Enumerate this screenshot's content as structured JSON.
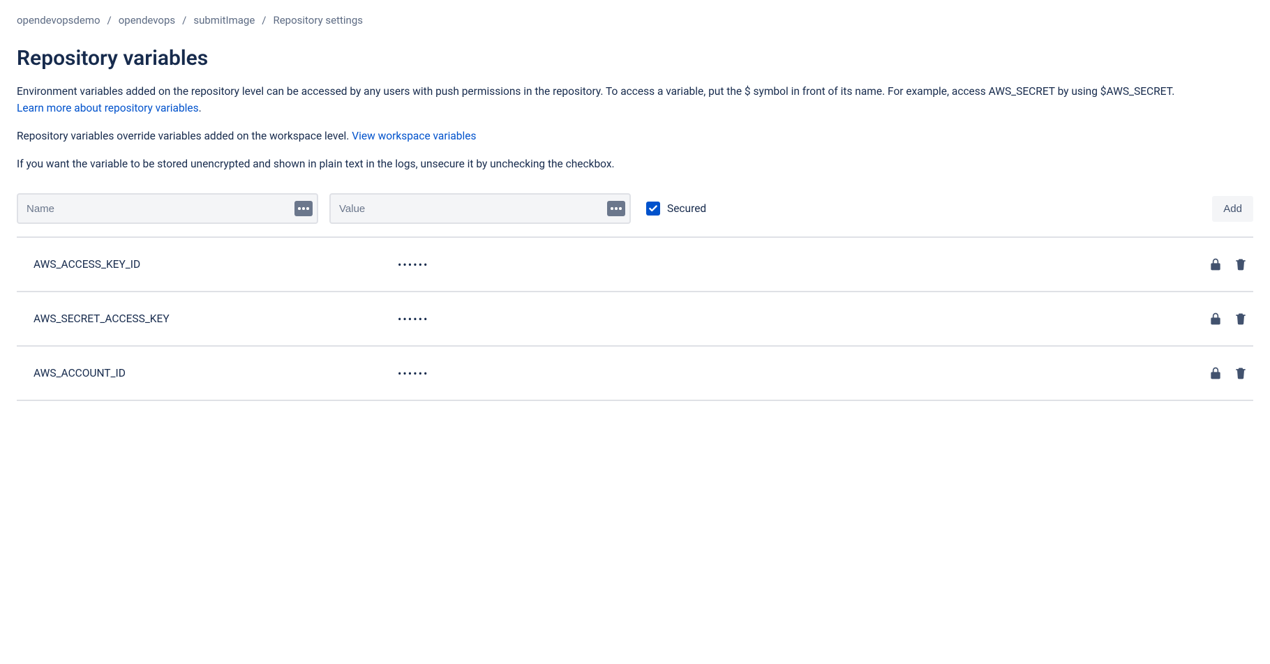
{
  "breadcrumb": {
    "workspace": "opendevopsdemo",
    "project": "opendevops",
    "repo": "submitImage",
    "section": "Repository settings"
  },
  "title": "Repository variables",
  "description": {
    "para1": "Environment variables added on the repository level can be accessed by any users with push permissions in the repository. To access a variable, put the $ symbol in front of its name. For example, access AWS_SECRET by using $AWS_SECRET.",
    "learn_more": "Learn more about repository variables",
    "para2_pre": "Repository variables override variables added on the workspace level. ",
    "view_workspace": "View workspace variables",
    "para3": "If you want the variable to be stored unencrypted and shown in plain text in the logs, unsecure it by unchecking the checkbox."
  },
  "form": {
    "name_placeholder": "Name",
    "value_placeholder": "Value",
    "secured_label": "Secured",
    "secured_checked": true,
    "add_label": "Add"
  },
  "variables": [
    {
      "name": "AWS_ACCESS_KEY_ID",
      "value": "••••••",
      "secured": true
    },
    {
      "name": "AWS_SECRET_ACCESS_KEY",
      "value": "••••••",
      "secured": true
    },
    {
      "name": "AWS_ACCOUNT_ID",
      "value": "••••••",
      "secured": true
    }
  ]
}
